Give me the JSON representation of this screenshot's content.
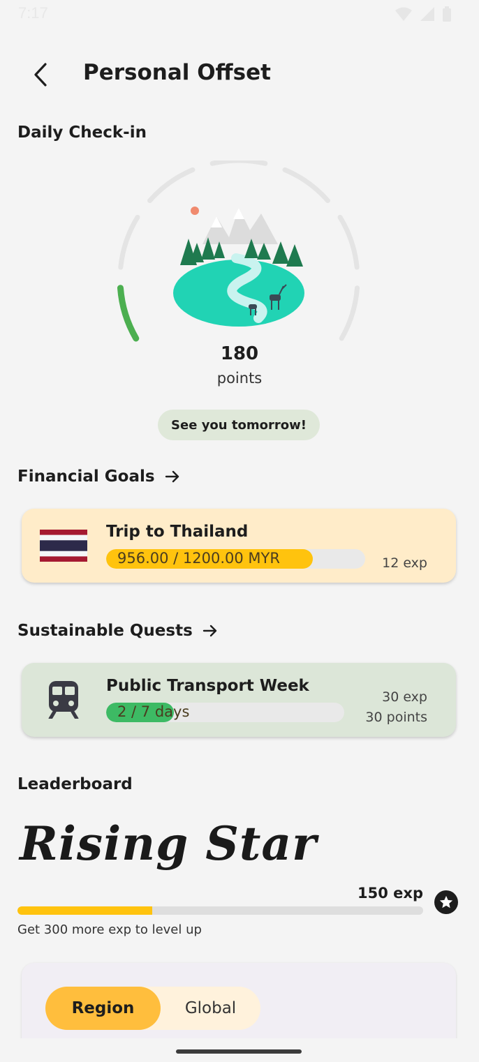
{
  "status_bar": {
    "time": "7:17"
  },
  "header": {
    "title": "Personal Offset"
  },
  "daily_checkin": {
    "title": "Daily Check-in",
    "points": "180",
    "points_label": "points",
    "button_label": "See you tomorrow!",
    "progress_segments": 1,
    "total_segments": 7
  },
  "financial_goals": {
    "title": "Financial Goals",
    "goal": {
      "name": "Trip to Thailand",
      "progress_text": "956.00 / 1200.00 MYR",
      "current": 956.0,
      "target": 1200.0,
      "reward": "12 exp",
      "fill_color": "#ffc30e"
    }
  },
  "sustainable_quests": {
    "title": "Sustainable Quests",
    "quest": {
      "name": "Public Transport Week",
      "progress_text": "2 / 7 days",
      "current": 2,
      "target": 7,
      "reward_exp": "30 exp",
      "reward_points": "30 points",
      "fill_color": "#3dba64"
    }
  },
  "leaderboard": {
    "title": "Leaderboard",
    "rank_name": "Rising Star",
    "exp": "150 exp",
    "level_progress": 0.333,
    "levelup_text": "Get 300 more exp to level up",
    "tabs": {
      "active": "Region",
      "inactive": "Global"
    }
  },
  "colors": {
    "accent": "#ffbe3d",
    "checkin_green": "#4caf50"
  }
}
